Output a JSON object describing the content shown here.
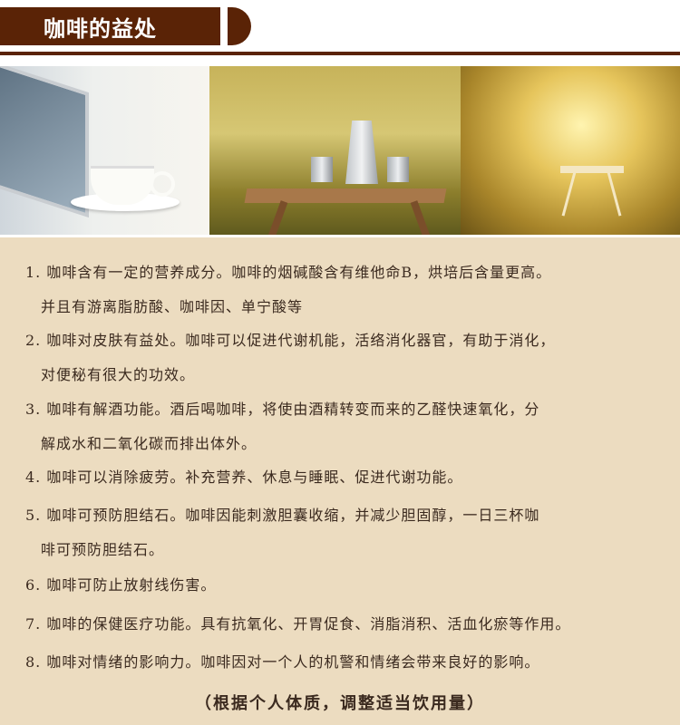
{
  "header": {
    "title": "咖啡的益处"
  },
  "photos": [
    {
      "icon": "coffee-cup-laptop-photo"
    },
    {
      "icon": "moka-pot-table-photo"
    },
    {
      "icon": "sunset-table-photo"
    }
  ],
  "items": [
    {
      "line1": "1. 咖啡含有一定的营养成分。咖啡的烟碱酸含有维他命B，烘培后含量更高。",
      "line2": "并且有游离脂肪酸、咖啡因、单宁酸等"
    },
    {
      "line1": "2. 咖啡对皮肤有益处。咖啡可以促进代谢机能，活络消化器官，有助于消化，",
      "line2": "对便秘有很大的功效。"
    },
    {
      "line1": "3. 咖啡有解酒功能。酒后喝咖啡，将使由酒精转变而来的乙醛快速氧化，分",
      "line2": "解成水和二氧化碳而排出体外。"
    },
    {
      "line1": "4. 咖啡可以消除疲劳。补充营养、休息与睡眠、促进代谢功能。",
      "line2": ""
    },
    {
      "line1": "5. 咖啡可预防胆结石。咖啡因能刺激胆囊收缩，并减少胆固醇，一日三杯咖",
      "line2": "啡可预防胆结石。"
    },
    {
      "line1": "6. 咖啡可防止放射线伤害。",
      "line2": ""
    },
    {
      "line1": "7. 咖啡的保健医疗功能。具有抗氧化、开胃促食、消脂消积、活血化瘀等作用。",
      "line2": ""
    },
    {
      "line1": "8. 咖啡对情绪的影响力。咖啡因对一个人的机警和情绪会带来良好的影响。",
      "line2": ""
    }
  ],
  "footer": {
    "note": "（根据个人体质，调整适当饮用量）"
  },
  "colors": {
    "brand": "#5a2306",
    "panel": "#ecdcc0",
    "text": "#3b2a1f"
  }
}
